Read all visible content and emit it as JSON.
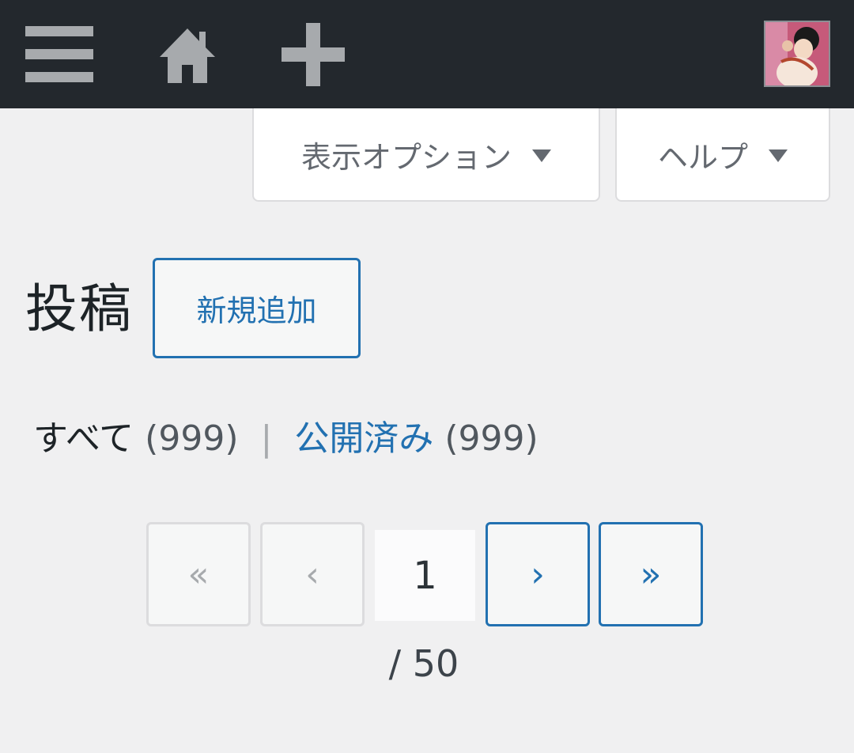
{
  "admin_bar": {
    "menu_icon": "hamburger-menu-icon",
    "home_icon": "home-icon",
    "new_icon": "plus-icon",
    "avatar": "user-avatar"
  },
  "screen_meta": {
    "screen_options_label": "表示オプション",
    "help_label": "ヘルプ"
  },
  "heading": {
    "title": "投稿",
    "add_new_label": "新規追加"
  },
  "views": {
    "all_label": "すべて",
    "all_count": "(999)",
    "separator": "|",
    "published_label": "公開済み",
    "published_count": "(999)"
  },
  "pagination": {
    "first": "«",
    "prev": "‹",
    "current_page": "1",
    "next": "›",
    "last": "»",
    "total": "/ 50"
  },
  "colors": {
    "admin_bar_bg": "#23282d",
    "accent": "#2271b1",
    "page_bg": "#f0f0f1"
  }
}
